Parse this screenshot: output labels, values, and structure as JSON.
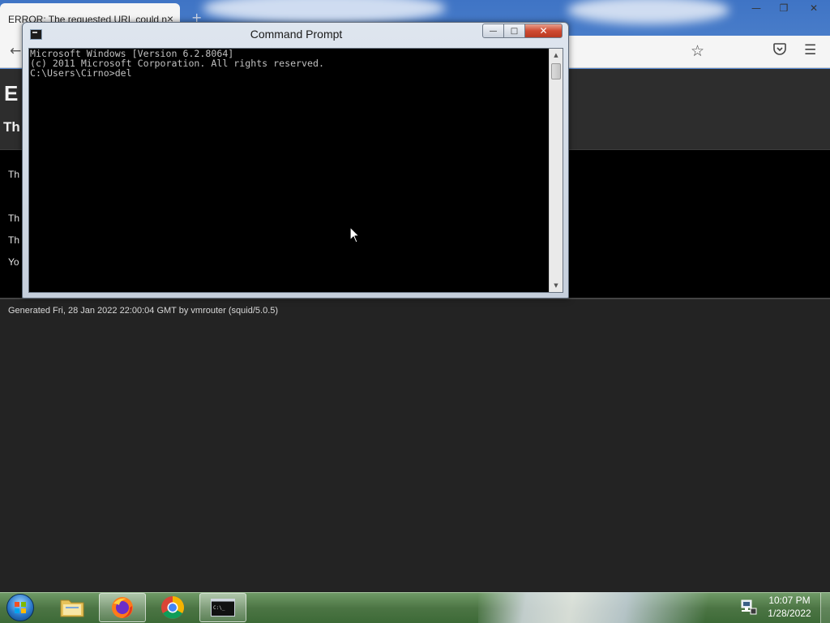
{
  "browser": {
    "tab_title": "ERROR: The requested URL could n",
    "tab_close": "×",
    "new_tab": "+",
    "window_controls": {
      "minimize": "—",
      "restore": "❐",
      "close": "✕"
    },
    "nav": {
      "back_icon": "arrow-left-icon",
      "bookmark_icon": "star-icon",
      "pocket_icon": "pocket-icon",
      "menu_icon": "hamburger-menu-icon"
    }
  },
  "page": {
    "heading_partial": "E",
    "subheading_partial": "Th",
    "body_lines": [
      "Th",
      "Th",
      "Th",
      "Yo"
    ],
    "generated": "Generated Fri, 28 Jan 2022 22:00:04 GMT by vmrouter (squid/5.0.5)"
  },
  "cmd": {
    "title": "Command Prompt",
    "lines": [
      "Microsoft Windows [Version 6.2.8064]",
      "(c) 2011 Microsoft Corporation. All rights reserved.",
      "",
      "C:\\Users\\Cirno>del"
    ],
    "buttons": {
      "minimize": "—",
      "maximize": "□",
      "close": "✕"
    }
  },
  "taskbar": {
    "items": [
      {
        "name": "file-explorer",
        "icon": "folder-icon",
        "active": false
      },
      {
        "name": "firefox",
        "icon": "firefox-icon",
        "active": true
      },
      {
        "name": "chrome",
        "icon": "chrome-icon",
        "active": false
      },
      {
        "name": "command-prompt",
        "icon": "cmd-icon",
        "active": true
      }
    ],
    "clock": {
      "time": "10:07 PM",
      "date": "1/28/2022"
    }
  }
}
